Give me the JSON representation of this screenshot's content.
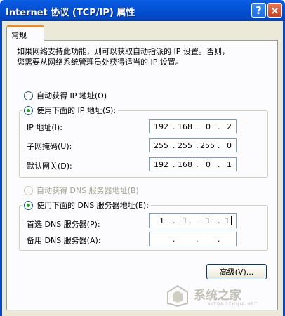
{
  "window": {
    "title": "Internet 协议 (TCP/IP) 属性",
    "help_label": "?",
    "close_label": "×"
  },
  "tabs": [
    {
      "label": "常规",
      "selected": true
    }
  ],
  "description": {
    "line1": "如果网络支持此功能，则可以获取自动指派的 IP 设置。否则，",
    "line2": "您需要从网络系统管理员处获得适当的 IP 设置。"
  },
  "ip_mode": {
    "auto_label": "自动获得 IP 地址(O)",
    "manual_label": "使用下面的 IP 地址(S):",
    "selected": "manual"
  },
  "ip_fields": {
    "ip": {
      "label": "IP 地址(I):",
      "octets": [
        "192",
        "168",
        "0",
        "2"
      ]
    },
    "mask": {
      "label": "子网掩码(U):",
      "octets": [
        "255",
        "255",
        "255",
        "0"
      ]
    },
    "gateway": {
      "label": "默认网关(D):",
      "octets": [
        "192",
        "168",
        "0",
        "1"
      ]
    }
  },
  "dns_mode": {
    "auto_label": "自动获得 DNS 服务器地址(B)",
    "manual_label": "使用下面的 DNS 服务器地址(E):",
    "selected": "manual",
    "auto_disabled": true
  },
  "dns_fields": {
    "preferred": {
      "label": "首选 DNS 服务器(P):",
      "octets": [
        "1",
        "1",
        "1",
        "1"
      ]
    },
    "alternate": {
      "label": "备用 DNS 服务器(A):",
      "octets": [
        "",
        "",
        "",
        ""
      ]
    }
  },
  "buttons": {
    "advanced_label": "高级(V)..."
  },
  "watermark": {
    "text": "系统之家",
    "sub": "XITONGZHIJIA.NET"
  },
  "colors": {
    "titlebar": "#0352d6",
    "frame": "#ece9d8",
    "tab_accent": "#e68b2c",
    "radio_dot": "#21a121"
  }
}
